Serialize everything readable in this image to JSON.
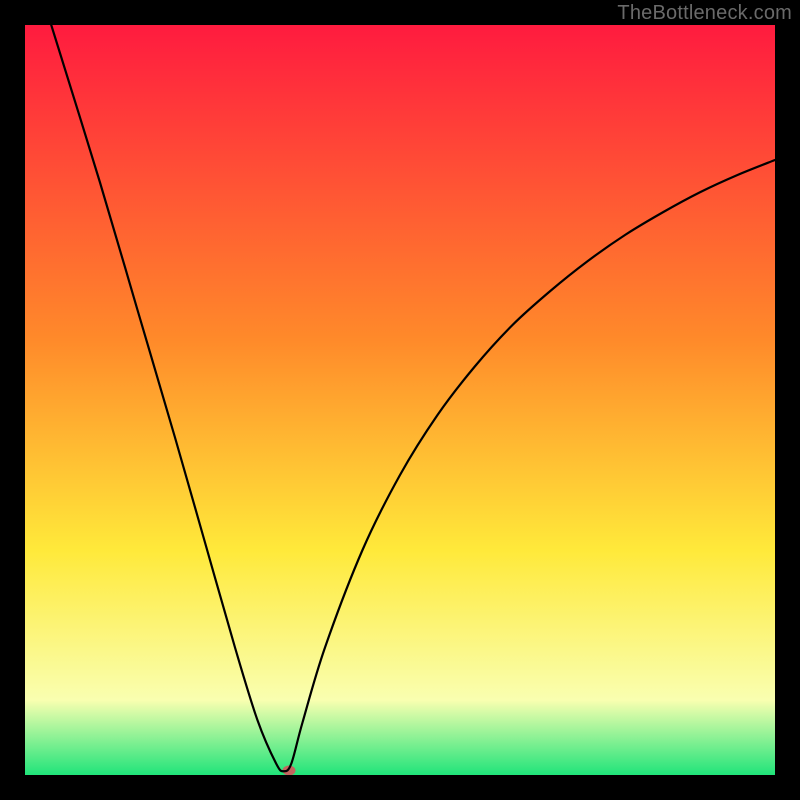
{
  "watermark": "TheBottleneck.com",
  "chart_data": {
    "type": "line",
    "title": "",
    "xlabel": "",
    "ylabel": "",
    "xlim": [
      0,
      100
    ],
    "ylim": [
      0,
      100
    ],
    "grid": false,
    "background_gradient": {
      "top": "#ff1b3f",
      "mid_upper": "#ff8a2a",
      "mid": "#ffe93a",
      "mid_lower": "#f9ffb0",
      "bottom": "#20e47a"
    },
    "series": [
      {
        "name": "bottleneck-curve",
        "color": "#000000",
        "x": [
          3.5,
          10,
          15,
          20,
          24,
          28,
          31,
          33.5,
          34.5,
          35.5,
          37,
          40,
          45,
          50,
          55,
          60,
          65,
          70,
          75,
          80,
          85,
          90,
          95,
          100
        ],
        "y": [
          100,
          79,
          62,
          45,
          31,
          17,
          7.3,
          1.5,
          0.5,
          1.5,
          7,
          17,
          30,
          40,
          48,
          54.5,
          60,
          64.5,
          68.5,
          72,
          75,
          77.7,
          80,
          82
        ]
      }
    ],
    "marker": {
      "name": "optimal-point",
      "x": 35.2,
      "y": 0.6,
      "color": "#c4655f",
      "rx": 6.5,
      "ry": 5
    }
  }
}
